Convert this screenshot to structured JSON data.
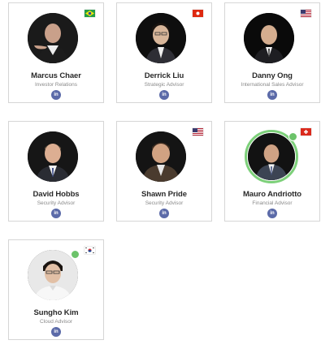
{
  "team": [
    {
      "name": "Marcus Chaer",
      "role": "Investor Relations",
      "flag": "brazil-flag",
      "online": false,
      "linkedin": "in"
    },
    {
      "name": "Derrick Liu",
      "role": "Strategic Advisor",
      "flag": "hong-kong-flag",
      "online": false,
      "linkedin": "in"
    },
    {
      "name": "Danny Ong",
      "role": "International Sales Advisor",
      "flag": "usa-flag",
      "online": false,
      "linkedin": "in"
    },
    {
      "name": "David Hobbs",
      "role": "Security Advisor",
      "flag": "",
      "online": false,
      "linkedin": "in"
    },
    {
      "name": "Shawn Pride",
      "role": "Security Advisor",
      "flag": "usa-flag",
      "online": false,
      "linkedin": "in"
    },
    {
      "name": "Mauro Andriotto",
      "role": "Financial Advisor",
      "flag": "switzerland-flag",
      "online": true,
      "linkedin": "in"
    },
    {
      "name": "Sungho Kim",
      "role": "Cloud Advisor",
      "flag": "south-korea-flag",
      "online": true,
      "linkedin": "in"
    }
  ],
  "colors": {
    "card_border": "#d6d6d6",
    "name_text": "#2a2a2a",
    "role_text": "#8a8a8a",
    "linkedin_bg": "#5b6aa8",
    "online_ring": "#7dd07a",
    "online_dot": "#6cc36a"
  }
}
